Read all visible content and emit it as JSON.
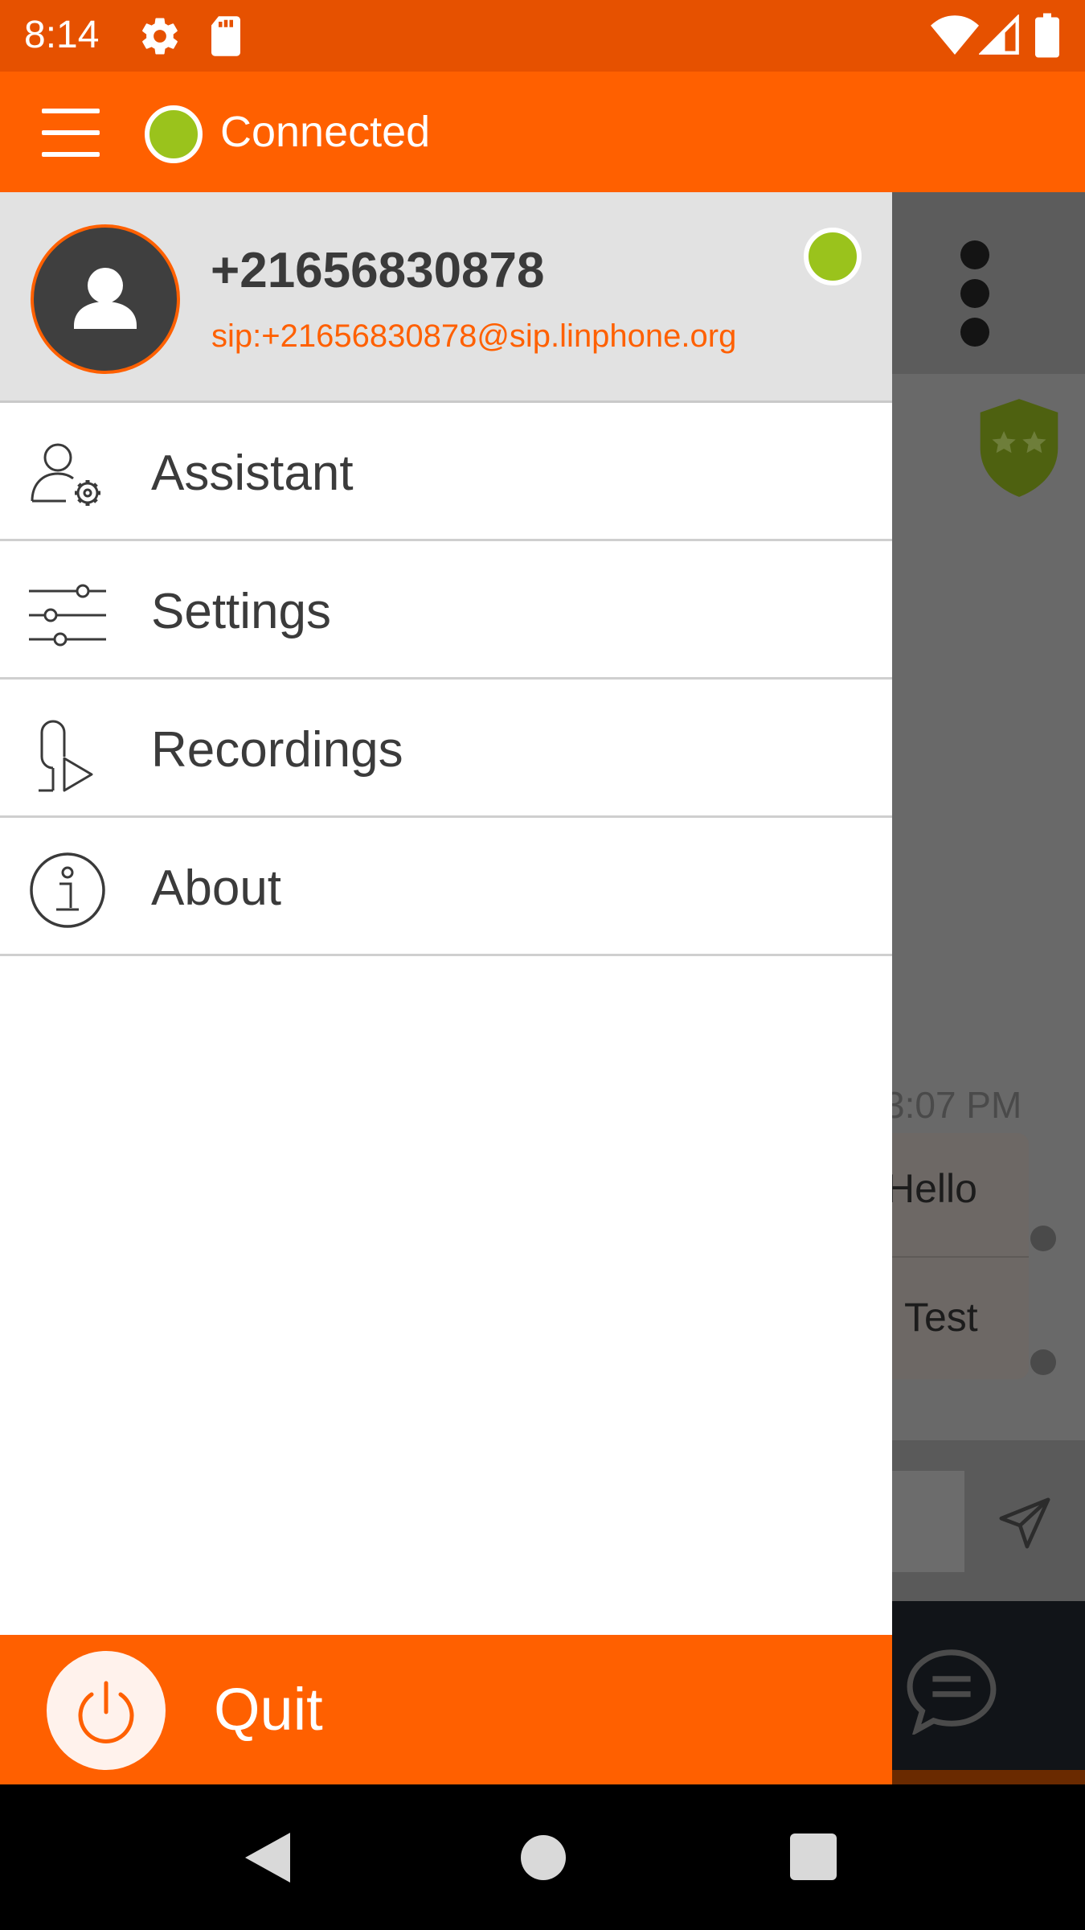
{
  "status_bar": {
    "time": "8:14"
  },
  "app_bar": {
    "connection_status": "Connected",
    "status_color": "#9ac31c"
  },
  "drawer": {
    "account": {
      "number": "+21656830878",
      "sip_address": "sip:+21656830878@sip.linphone.org",
      "status_color": "#9ac31c"
    },
    "items": [
      {
        "label": "Assistant",
        "icon": "assistant-icon"
      },
      {
        "label": "Settings",
        "icon": "settings-sliders-icon"
      },
      {
        "label": "Recordings",
        "icon": "recordings-icon"
      },
      {
        "label": "About",
        "icon": "info-icon"
      }
    ],
    "quit_label": "Quit"
  },
  "background_chat": {
    "timestamp": "3:07 PM",
    "messages": [
      "Hello",
      "Test"
    ]
  },
  "colors": {
    "accent": "#ff6000",
    "status_bar": "#e65100"
  }
}
